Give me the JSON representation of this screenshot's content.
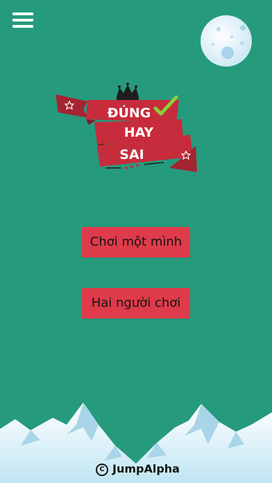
{
  "menu": {
    "icon": "hamburger-menu-icon"
  },
  "moon": {
    "icon": "moon-icon"
  },
  "logo": {
    "line1": "ĐÚNG",
    "line2": "HAY",
    "line3": "SAI",
    "icons": [
      "crown-icon",
      "checkmark-icon",
      "star-icon"
    ]
  },
  "buttons": {
    "single_player": "Chơi một mình",
    "two_player": "Hai người chơi"
  },
  "footer": {
    "copyright_symbol": "C",
    "brand": "JumpAlpha"
  },
  "colors": {
    "background": "#269a7d",
    "button": "#df3b4a",
    "ribbon": "#c62c3b",
    "moon": "#ddf2fb",
    "checkmark": "#8ccf3a"
  }
}
